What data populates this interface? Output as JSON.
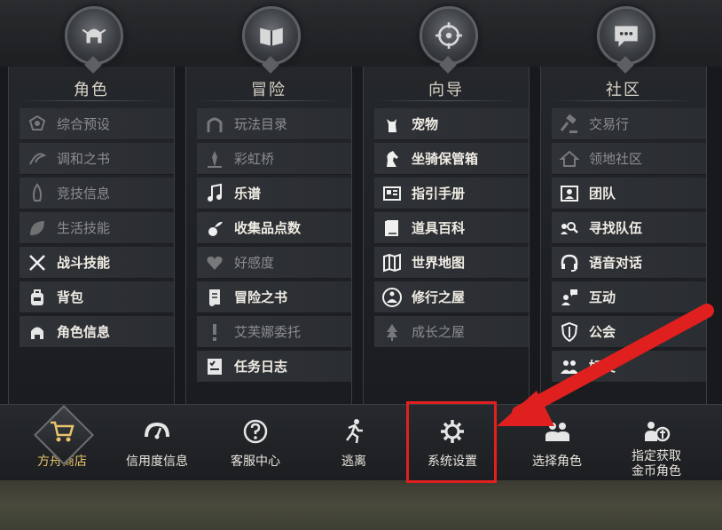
{
  "columns": [
    {
      "title": "角色",
      "emblem": "helmet-icon",
      "items": [
        {
          "label": "综合预设",
          "icon": "crest-icon",
          "dim": true
        },
        {
          "label": "调和之书",
          "icon": "swirl-icon",
          "dim": true
        },
        {
          "label": "竞技信息",
          "icon": "flame-icon",
          "dim": true
        },
        {
          "label": "生活技能",
          "icon": "leaf-icon",
          "dim": true
        },
        {
          "label": "战斗技能",
          "icon": "crossed-swords-icon",
          "dim": false
        },
        {
          "label": "背包",
          "icon": "backpack-icon",
          "dim": false
        },
        {
          "label": "角色信息",
          "icon": "helmet-icon",
          "dim": false
        }
      ]
    },
    {
      "title": "冒险",
      "emblem": "book-icon",
      "items": [
        {
          "label": "玩法目录",
          "icon": "arch-icon",
          "dim": true
        },
        {
          "label": "彩虹桥",
          "icon": "portal-icon",
          "dim": true
        },
        {
          "label": "乐谱",
          "icon": "music-note-icon",
          "dim": false
        },
        {
          "label": "收集品点数",
          "icon": "sprout-icon",
          "dim": false
        },
        {
          "label": "好感度",
          "icon": "heart-icon",
          "dim": true
        },
        {
          "label": "冒险之书",
          "icon": "scroll-icon",
          "dim": false
        },
        {
          "label": "艾芙娜委托",
          "icon": "exclamation-icon",
          "dim": true
        },
        {
          "label": "任务日志",
          "icon": "checklist-icon",
          "dim": false
        }
      ]
    },
    {
      "title": "向导",
      "emblem": "compass-icon",
      "items": [
        {
          "label": "宠物",
          "icon": "cat-icon",
          "dim": false
        },
        {
          "label": "坐骑保管箱",
          "icon": "horse-icon",
          "dim": false
        },
        {
          "label": "指引手册",
          "icon": "manual-icon",
          "dim": false
        },
        {
          "label": "道具百科",
          "icon": "encyclopedia-icon",
          "dim": false
        },
        {
          "label": "世界地图",
          "icon": "map-icon",
          "dim": false
        },
        {
          "label": "修行之屋",
          "icon": "meditation-icon",
          "dim": false
        },
        {
          "label": "成长之屋",
          "icon": "tree-icon",
          "dim": true
        }
      ]
    },
    {
      "title": "社区",
      "emblem": "chat-bubble-icon",
      "items": [
        {
          "label": "交易行",
          "icon": "gavel-icon",
          "dim": true
        },
        {
          "label": "领地社区",
          "icon": "house-icon",
          "dim": true
        },
        {
          "label": "团队",
          "icon": "team-icon",
          "dim": false
        },
        {
          "label": "寻找队伍",
          "icon": "search-party-icon",
          "dim": false
        },
        {
          "label": "语音对话",
          "icon": "headset-icon",
          "dim": false
        },
        {
          "label": "互动",
          "icon": "interact-icon",
          "dim": false
        },
        {
          "label": "公会",
          "icon": "shield-icon",
          "dim": false
        },
        {
          "label": "好友",
          "icon": "friends-icon",
          "dim": false
        }
      ]
    }
  ],
  "bottom_bar": [
    {
      "label": "方舟商店",
      "icon": "cart-icon"
    },
    {
      "label": "信用度信息",
      "icon": "gauge-icon"
    },
    {
      "label": "客服中心",
      "icon": "help-icon"
    },
    {
      "label": "逃离",
      "icon": "run-icon"
    },
    {
      "label": "系统设置",
      "icon": "gear-icon"
    },
    {
      "label": "选择角色",
      "icon": "characters-icon"
    },
    {
      "label": "指定获取\n金币角色",
      "icon": "coin-character-icon"
    }
  ],
  "colors": {
    "highlight": "#e0201f",
    "shop_label": "#e8c46a"
  }
}
